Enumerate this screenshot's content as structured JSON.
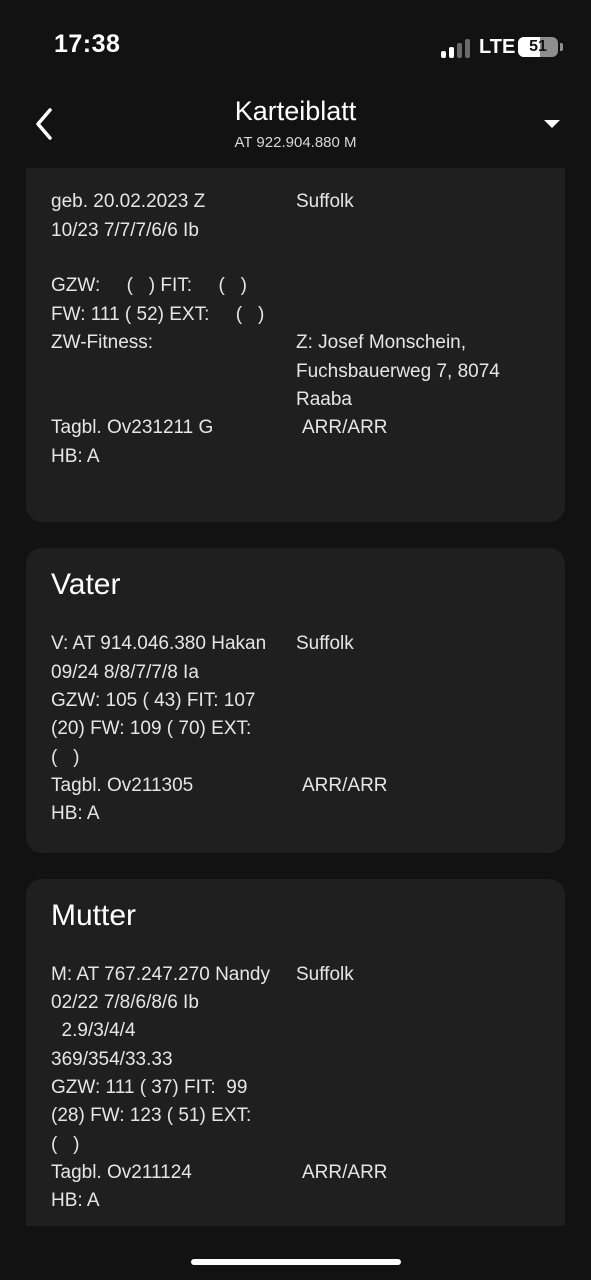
{
  "status": {
    "time": "17:38",
    "network": "LTE",
    "battery": "51"
  },
  "nav": {
    "title": "Karteiblatt",
    "subtitle": "AT 922.904.880 M"
  },
  "top_card": {
    "birth": "geb. 20.02.2023 Z",
    "breed": "Suffolk",
    "scores": "10/23 7/7/7/6/6 Ib",
    "gzw_line": "GZW:     (   ) FIT:     (   )",
    "fw_line": "FW: 111 ( 52) EXT:     (   )",
    "zw_fitness": "ZW-Fitness:",
    "breeder_1": "Z: Josef Monschein,",
    "breeder_2": "Fuchsbauerweg 7, 8074",
    "breeder_3": "Raaba",
    "tagbl": "Tagbl. Ov231211 G",
    "arr": "ARR/ARR",
    "hb": "HB: A"
  },
  "vater": {
    "title": "Vater",
    "id_line": "V: AT 914.046.380 Hakan",
    "breed": "Suffolk",
    "scores": "09/24 8/8/7/7/8 Ia",
    "gzw_line": "GZW: 105 ( 43) FIT: 107",
    "fw_line": "(20) FW: 109 ( 70) EXT:",
    "ext_line": "(   )",
    "tagbl": "Tagbl. Ov211305",
    "arr": "ARR/ARR",
    "hb": "HB: A"
  },
  "mutter": {
    "title": "Mutter",
    "id_line": "M: AT 767.247.270 Nandy",
    "breed": "Suffolk",
    "scores": "02/22 7/8/6/8/6 Ib",
    "scores_2": "  2.9/3/4/4",
    "scores_3": "369/354/33.33",
    "gzw_line": "GZW: 111 ( 37) FIT:  99",
    "fw_line": "(28) FW: 123 ( 51) EXT:",
    "ext_line": "(   )",
    "tagbl": "Tagbl. Ov211124",
    "arr": "ARR/ARR",
    "hb": "HB: A"
  }
}
